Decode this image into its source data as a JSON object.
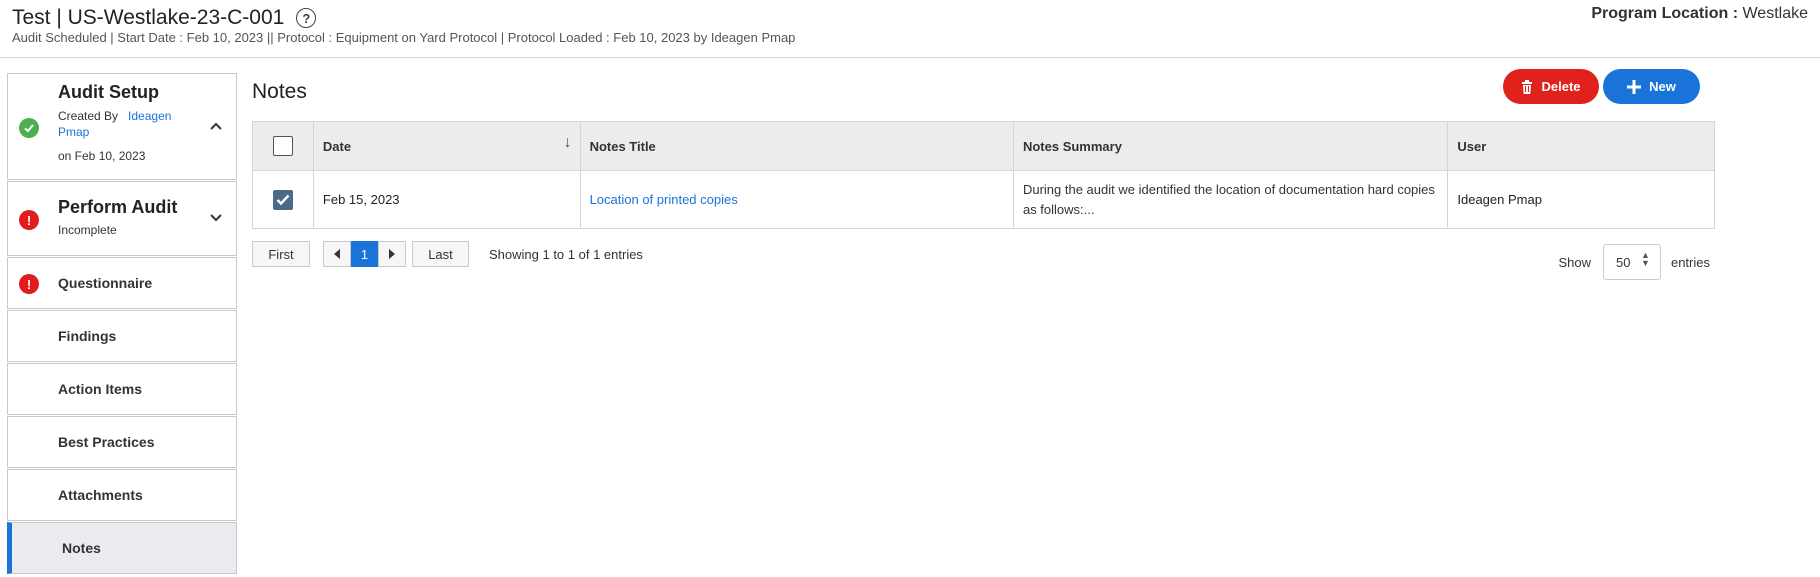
{
  "header": {
    "title": "Test | US-Westlake-23-C-001",
    "help_glyph": "?",
    "subtitle": "Audit Scheduled | Start Date : Feb 10, 2023 || Protocol : Equipment on Yard Protocol | Protocol Loaded : Feb 10, 2023 by Ideagen Pmap",
    "program_location_label": "Program Location :",
    "program_location_value": "Westlake"
  },
  "sidebar": {
    "audit_setup": {
      "title": "Audit Setup",
      "created_by_label": "Created By",
      "created_by_user_line1": "Ideagen",
      "created_by_user_line2": "Pmap",
      "date": "on Feb 10, 2023"
    },
    "perform_audit": {
      "title": "Perform Audit",
      "status": "Incomplete"
    },
    "items": [
      {
        "label": "Questionnaire"
      },
      {
        "label": "Findings"
      },
      {
        "label": "Action Items"
      },
      {
        "label": "Best Practices"
      },
      {
        "label": "Attachments"
      },
      {
        "label": "Notes"
      }
    ]
  },
  "main": {
    "title": "Notes",
    "delete_label": "Delete",
    "new_label": "New",
    "columns": [
      "Date",
      "Notes Title",
      "Notes Summary",
      "User"
    ],
    "rows": [
      {
        "date": "Feb 15, 2023",
        "title": "Location of printed copies",
        "summary": "During the audit we identified the location of documentation hard copies as follows:...",
        "user": "Ideagen Pmap",
        "checked": true
      }
    ],
    "pagination": {
      "first": "First",
      "page": "1",
      "last": "Last",
      "showing": "Showing 1 to 1 of 1 entries"
    },
    "length": {
      "show": "Show",
      "value": "50",
      "entries": "entries"
    }
  },
  "colors": {
    "accent": "#1a73d9",
    "delete": "#e0221c",
    "ok": "#4caf50",
    "error": "#e21b1b"
  }
}
